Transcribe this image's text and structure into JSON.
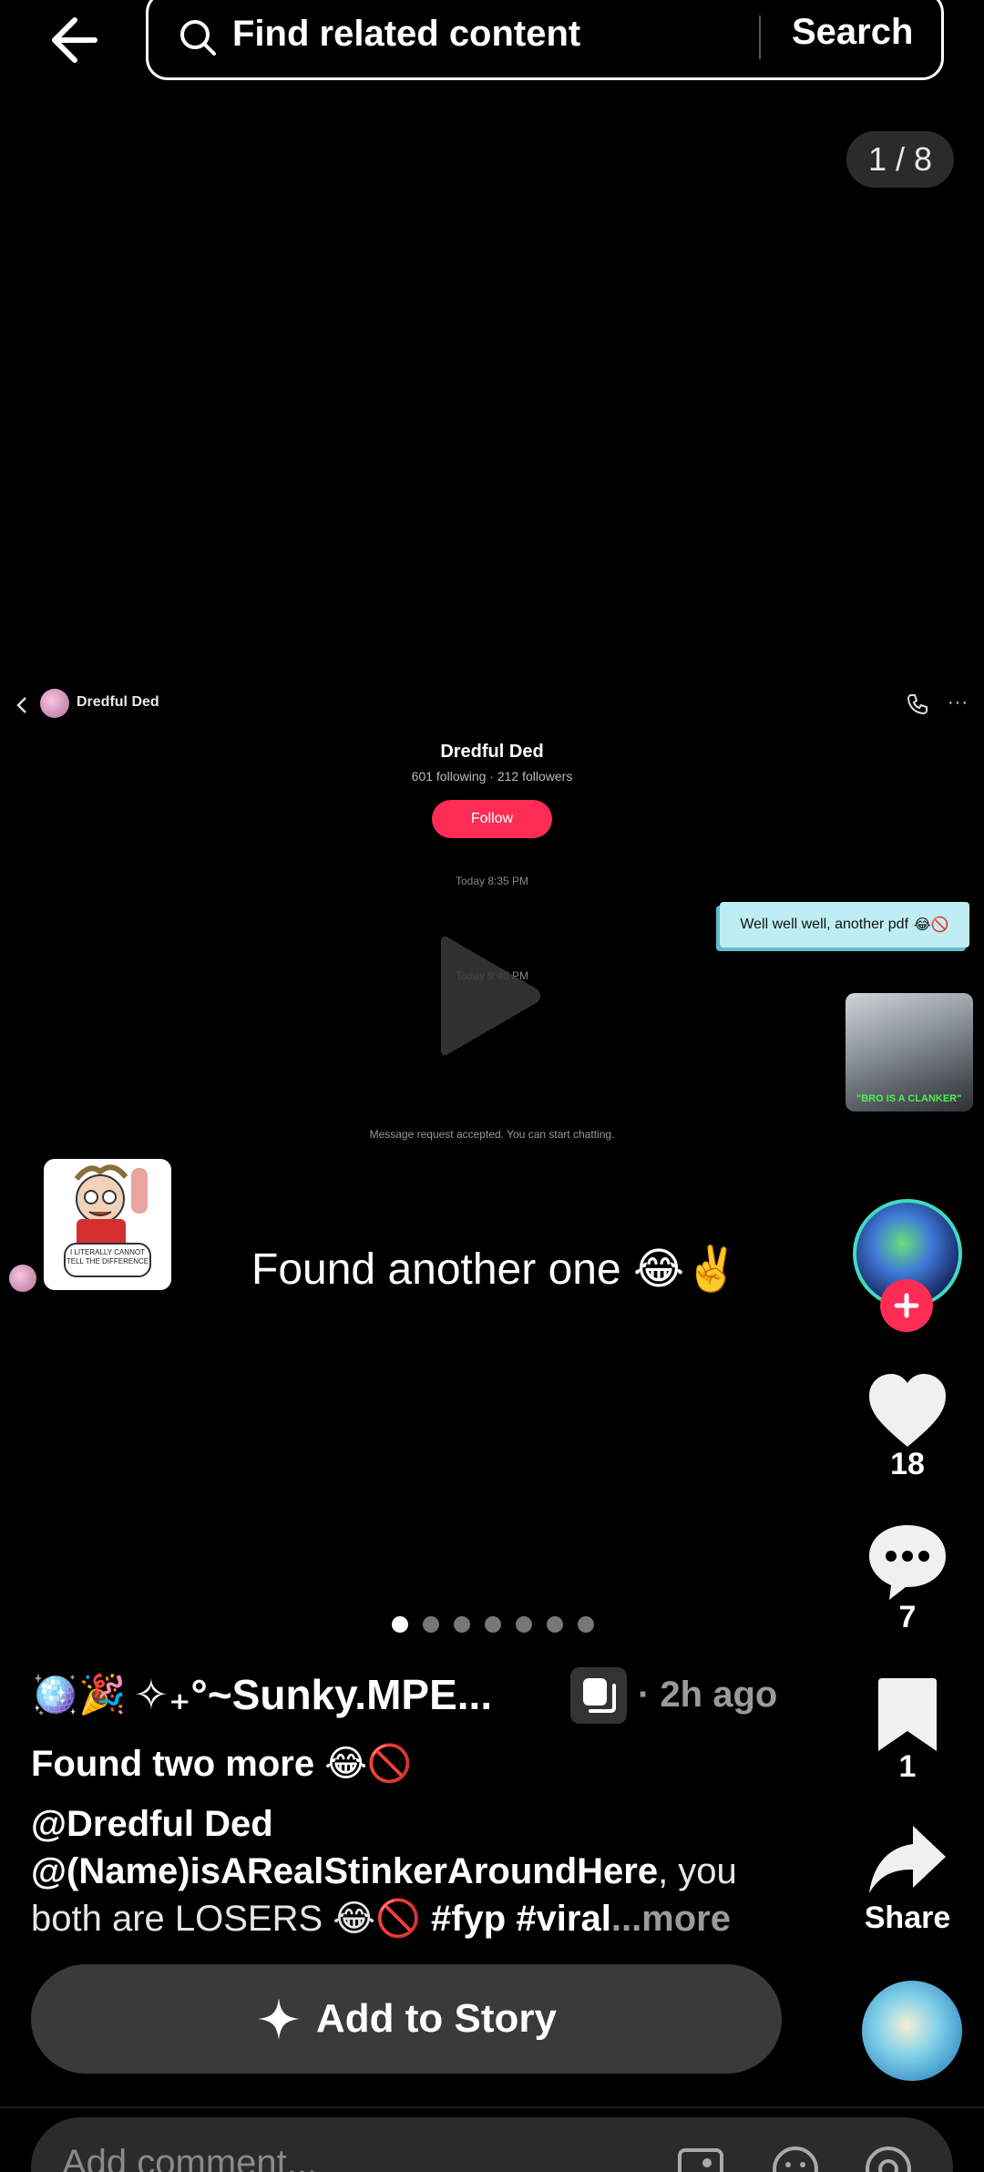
{
  "search": {
    "placeholder": "Find related content",
    "button_label": "Search"
  },
  "counter": "1 / 8",
  "embedded_screenshot": {
    "chat_name": "Dredful Ded",
    "profile_name": "Dredful Ded",
    "profile_stats": "601 following · 212 followers",
    "follow_label": "Follow",
    "time_1": "Today 8:35 PM",
    "time_2": "Today 9:40 PM",
    "bubble_text": "Well well well, another pdf",
    "bubble_emoji": "😂🚫",
    "thumb_text": "\"BRO IS A CLANKER\"",
    "accepted_text": "Message request accepted. You can start chatting."
  },
  "meme_caption": "I LITERALLY CANNOT TELL THE DIFFERENCE",
  "overlay_text": "Found another one 😂✌️",
  "rail": {
    "likes": "18",
    "comments": "7",
    "saves": "1",
    "share_label": "Share"
  },
  "dots": {
    "count": 7,
    "active": 0
  },
  "post": {
    "author_emoji": "🪩🎉",
    "author": "✧₊°~Sunky.MPE...",
    "time_ago": "· 2h ago",
    "title": "Found two more 😂🚫",
    "mention_1": "@Dredful Ded",
    "mention_2": "@(Name)isARealStinkerAroundHere",
    "desc_rest": ", you both are LOSERS 😂🚫 ",
    "tags": "#fyp #viral",
    "more": "...more"
  },
  "add_story_label": "Add to Story",
  "comment_placeholder": "Add comment..."
}
